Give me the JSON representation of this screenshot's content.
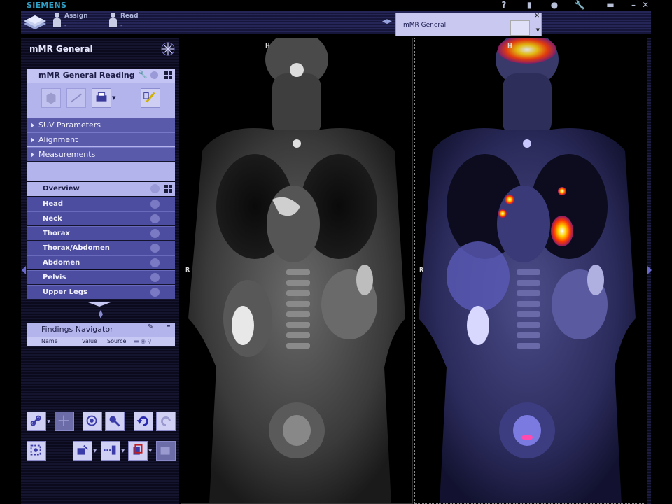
{
  "brand": "SIEMENS",
  "taskbar": {
    "tasks": [
      {
        "label": "Assign",
        "sub": "-"
      },
      {
        "label": "Read",
        "sub": "-"
      }
    ],
    "active_task": {
      "label": "mMR General"
    }
  },
  "panel": {
    "title": "mMR General",
    "reading_title": "mMR General Reading",
    "sections": [
      "SUV Parameters",
      "Alignment",
      "Measurements"
    ],
    "overview_label": "Overview",
    "regions": [
      "Head",
      "Neck",
      "Thorax",
      "Thorax/Abdomen",
      "Abdomen",
      "Pelvis",
      "Upper Legs"
    ],
    "findings": {
      "title": "Findings Navigator",
      "columns": [
        "Name",
        "Value",
        "Source"
      ]
    }
  },
  "viewers": {
    "left": {
      "top_marker": "H",
      "side_marker": "R"
    },
    "right": {
      "top_marker": "H",
      "side_marker": "R"
    }
  },
  "colors": {
    "accent": "#2fa0c8",
    "panel_light": "#b4b4ec",
    "panel_dark": "#4c4ca0",
    "fusion_hot": "#ff3a00"
  },
  "icons": {
    "top": [
      "help-icon",
      "device-icon",
      "globe-icon",
      "wrench-icon",
      "briefcase-icon",
      "minimize-icon",
      "close-icon"
    ]
  }
}
